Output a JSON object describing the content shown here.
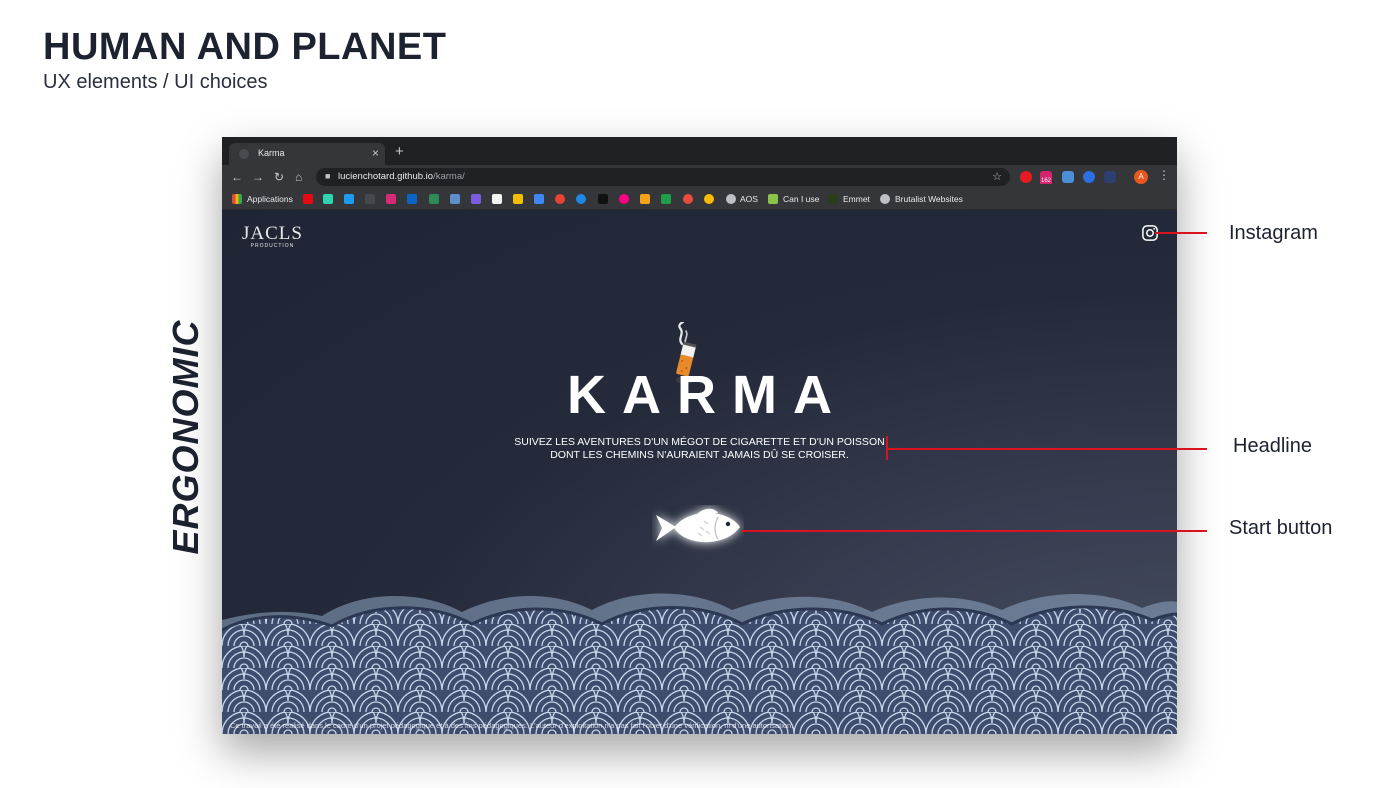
{
  "slide": {
    "title": "HUMAN AND PLANET",
    "subtitle": "UX elements / UI choices",
    "side_label": "ERGONOMIC"
  },
  "browser": {
    "tab_title": "Karma",
    "tab_close": "×",
    "new_tab": "+",
    "url_host": "lucienchotard.github.io",
    "url_path": "/karma/",
    "profile_initial": "A",
    "extension_badge": "162",
    "bookmarks": [
      "Applications",
      "AOS",
      "Can I use",
      "Emmet",
      "Brutalist Websites"
    ]
  },
  "page": {
    "logo_main": "JACLS",
    "logo_sub": "PRODUCTION",
    "title": "KARMA",
    "tagline_line1": "SUIVEZ LES AVENTURES D'UN MÉGOT DE CIGARETTE ET D'UN POISSON",
    "tagline_line2": "DONT LES CHEMINS N'AURAIENT JAMAIS DÛ SE CROISER.",
    "disclaimer": "Ce travail a été réalisé dans le cadre d'un projet pédagogique et à des fins pédagogiques. L'auteur d'exploitation n'a pas fait l'objet d'une vérification, ni d'une autorisation.",
    "icons": [
      "instagram-icon",
      "cigarette-icon",
      "fish-icon"
    ]
  },
  "annotations": {
    "instagram": "Instagram",
    "headline": "Headline",
    "start_button": "Start button",
    "line_color": "#d9141f"
  },
  "colors": {
    "page_bg_dark": "#1f2534",
    "wave_blue": "#3e4d6e",
    "wave_line": "#c9d6ea"
  }
}
